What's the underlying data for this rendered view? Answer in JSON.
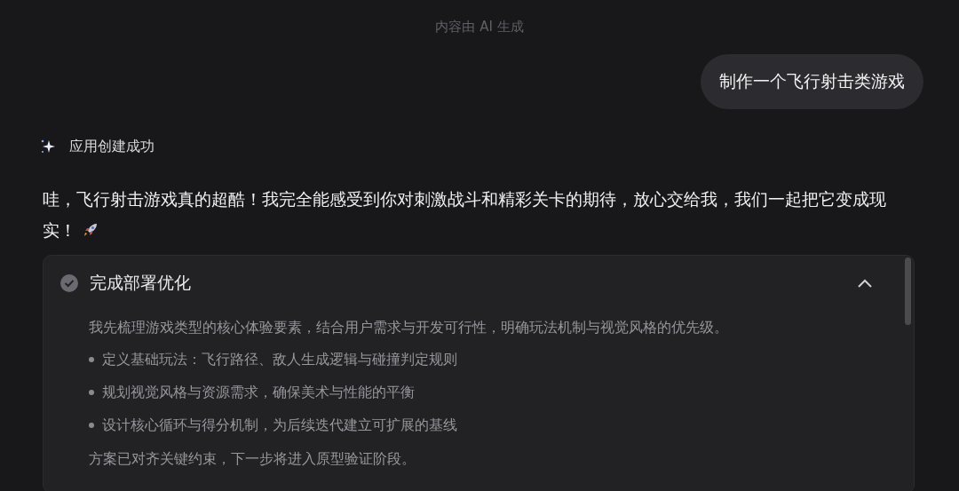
{
  "notice": "内容由 AI 生成",
  "user_message": "制作一个飞行射击类游戏",
  "status": {
    "text": "应用创建成功"
  },
  "reply": "哇，飞行射击游戏真的超酷！我完全能感受到你对刺激战斗和精彩关卡的期待，放心交给我，我们一起把它变成现实！",
  "steps": [
    {
      "title": "完成部署优化",
      "done": true,
      "expanded": true,
      "intro": "我先梳理游戏类型的核心体验要素，结合用户需求与开发可行性，明确玩法机制与视觉风格的优先级。",
      "bullets": [
        "定义基础玩法：飞行路径、敌人生成逻辑与碰撞判定规则",
        "规划视觉风格与资源需求，确保美术与性能的平衡",
        "设计核心循环与得分机制，为后续迭代建立可扩展的基线"
      ],
      "summary": "方案已对齐关键约束，下一步将进入原型验证阶段。"
    }
  ]
}
